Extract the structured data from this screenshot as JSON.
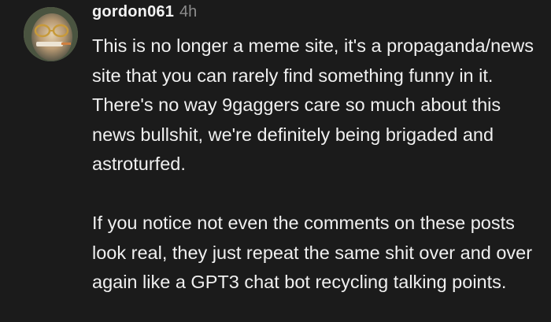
{
  "comment": {
    "avatar_icon": "user-avatar-photo",
    "username": "gordon061",
    "time_ago": "4h",
    "paragraphs": [
      "This is no longer a meme site, it's a propaganda/news site that you can rarely find something funny in it. There's no way 9gaggers care so much about this news bullshit, we're definitely being brigaded and astroturfed.",
      "If you notice not even the comments on these posts look real, they just repeat the same shit over and over again like a GPT3 chat bot recycling talking points."
    ]
  },
  "colors": {
    "background": "#1b1b1b",
    "text": "#f0f0f0",
    "muted": "#8c8c8c"
  }
}
